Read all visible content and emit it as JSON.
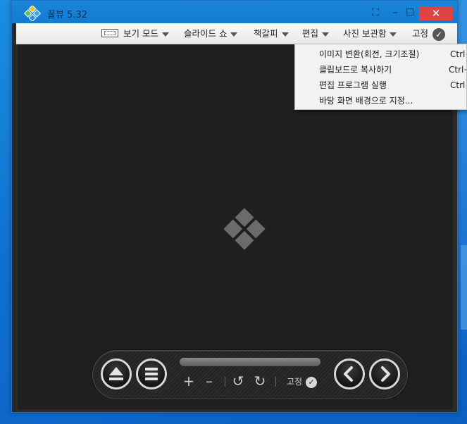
{
  "window": {
    "title": "꿀뷰 5.32",
    "controls": {
      "fullscreen": "⛶",
      "minimize": "–",
      "maximize": "☐",
      "close": "✕"
    }
  },
  "menubar": {
    "view_mode": "보기 모드",
    "slideshow": "슬라이드 쇼",
    "bookmark": "책갈피",
    "edit": "편집",
    "photo_storage": "사진 보관함",
    "pin": "고정"
  },
  "edit_menu": {
    "items": [
      {
        "label": "이미지 변환(회전, 크기조절)",
        "shortcut": "Ctrl+"
      },
      {
        "label": "클립보드로 복사하기",
        "shortcut": "Ctrl+"
      },
      {
        "label": "편집 프로그램 실행",
        "shortcut": "Ctrl+"
      },
      {
        "label": "바탕 화면 배경으로 지정...",
        "shortcut": ""
      }
    ]
  },
  "control_bar": {
    "progress": 0,
    "zoom_in": "+",
    "zoom_out": "–",
    "rotate_left": "↺",
    "rotate_right": "↻",
    "pin_label": "고정"
  },
  "icons": {
    "app": "honeyview-logo-icon",
    "placeholder": "honeyview-placeholder-icon",
    "check": "check-icon",
    "eject": "eject-icon",
    "menu": "list-icon",
    "prev": "chevron-left-icon",
    "next": "chevron-right-icon"
  },
  "colors": {
    "titlebar": "#1a86d9",
    "close_button": "#e04343",
    "viewer_background": "#1f1f1f"
  }
}
